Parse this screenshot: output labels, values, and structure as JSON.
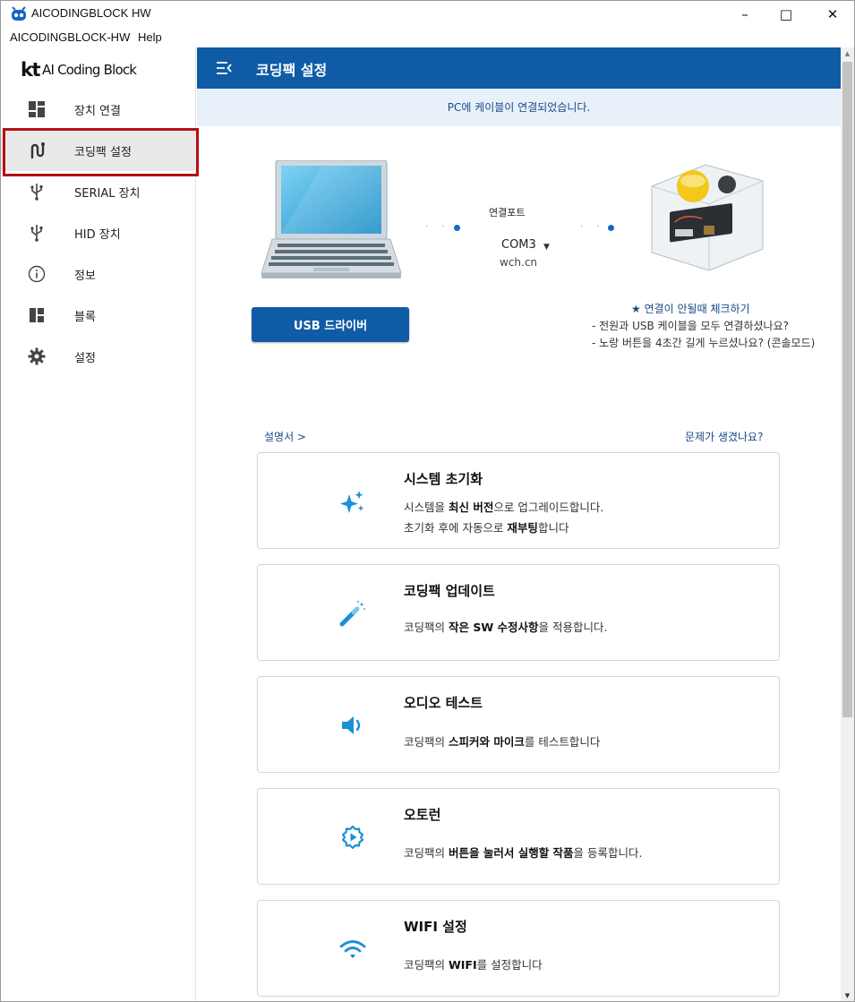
{
  "window": {
    "title": "AICODINGBLOCK HW",
    "minimize": "–",
    "maximize": "□",
    "close": "✕"
  },
  "menubar": {
    "items": [
      "AICODINGBLOCK-HW",
      "Help"
    ]
  },
  "sidebar": {
    "logo_kt": "kt",
    "logo_text": "AI Coding Block",
    "items": [
      {
        "label": "장치 연결",
        "icon": "dashboard-icon"
      },
      {
        "label": "코딩팩 설정",
        "icon": "coding-pack-icon",
        "active": true
      },
      {
        "label": "SERIAL 장치",
        "icon": "usb-icon"
      },
      {
        "label": "HID 장치",
        "icon": "usb-icon"
      },
      {
        "label": "정보",
        "icon": "info-icon"
      },
      {
        "label": "블록",
        "icon": "blocks-icon"
      },
      {
        "label": "설정",
        "icon": "gear-icon"
      }
    ]
  },
  "header": {
    "title": "코딩팩 설정"
  },
  "status": {
    "message": "PC에 케이블이 연결되었습니다."
  },
  "connection": {
    "port_label": "연결포트",
    "port_value": "COM3",
    "port_sub": "wch.cn",
    "usb_button": "USB 드라이버",
    "help_title": "★ 연결이 안될때 체크하기",
    "help_lines": [
      "- 전원과 USB 케이블을 모두 연결하셨나요?",
      "- 노랑 버튼을 4초간 길게 누르셨나요? (콘솔모드)"
    ]
  },
  "links": {
    "manual": "설명서  >",
    "trouble": "문제가 생겼나요?"
  },
  "cards": [
    {
      "title": "시스템 초기화",
      "icon": "sparkle-icon",
      "line1": [
        "시스템을 ",
        "최신 버전",
        "으로 업그레이드합니다."
      ],
      "line2": [
        "초기화 후에 자동으로 ",
        "재부팅",
        "합니다"
      ]
    },
    {
      "title": "코딩팩 업데이트",
      "icon": "magic-wand-icon",
      "line1": [
        "코딩팩의 ",
        "작은 SW 수정사항",
        "을 적용합니다."
      ]
    },
    {
      "title": "오디오 테스트",
      "icon": "speaker-icon",
      "line1": [
        "코딩팩의 ",
        "스피커와 마이크",
        "를 테스트합니다"
      ]
    },
    {
      "title": "오토런",
      "icon": "autorun-gear-icon",
      "line1": [
        "코딩팩의 ",
        "버튼을 눌러서 실행할 작품",
        "을 등록합니다."
      ]
    },
    {
      "title": "WIFI 설정",
      "icon": "wifi-icon",
      "line1": [
        "코딩팩의 ",
        "WIFI",
        "를 설정합니다"
      ]
    }
  ],
  "colors": {
    "accent": "#0f5ba6",
    "status_bg": "#e8f1f9",
    "icon_accent": "#1d8fd6",
    "highlight": "#b40f14"
  }
}
